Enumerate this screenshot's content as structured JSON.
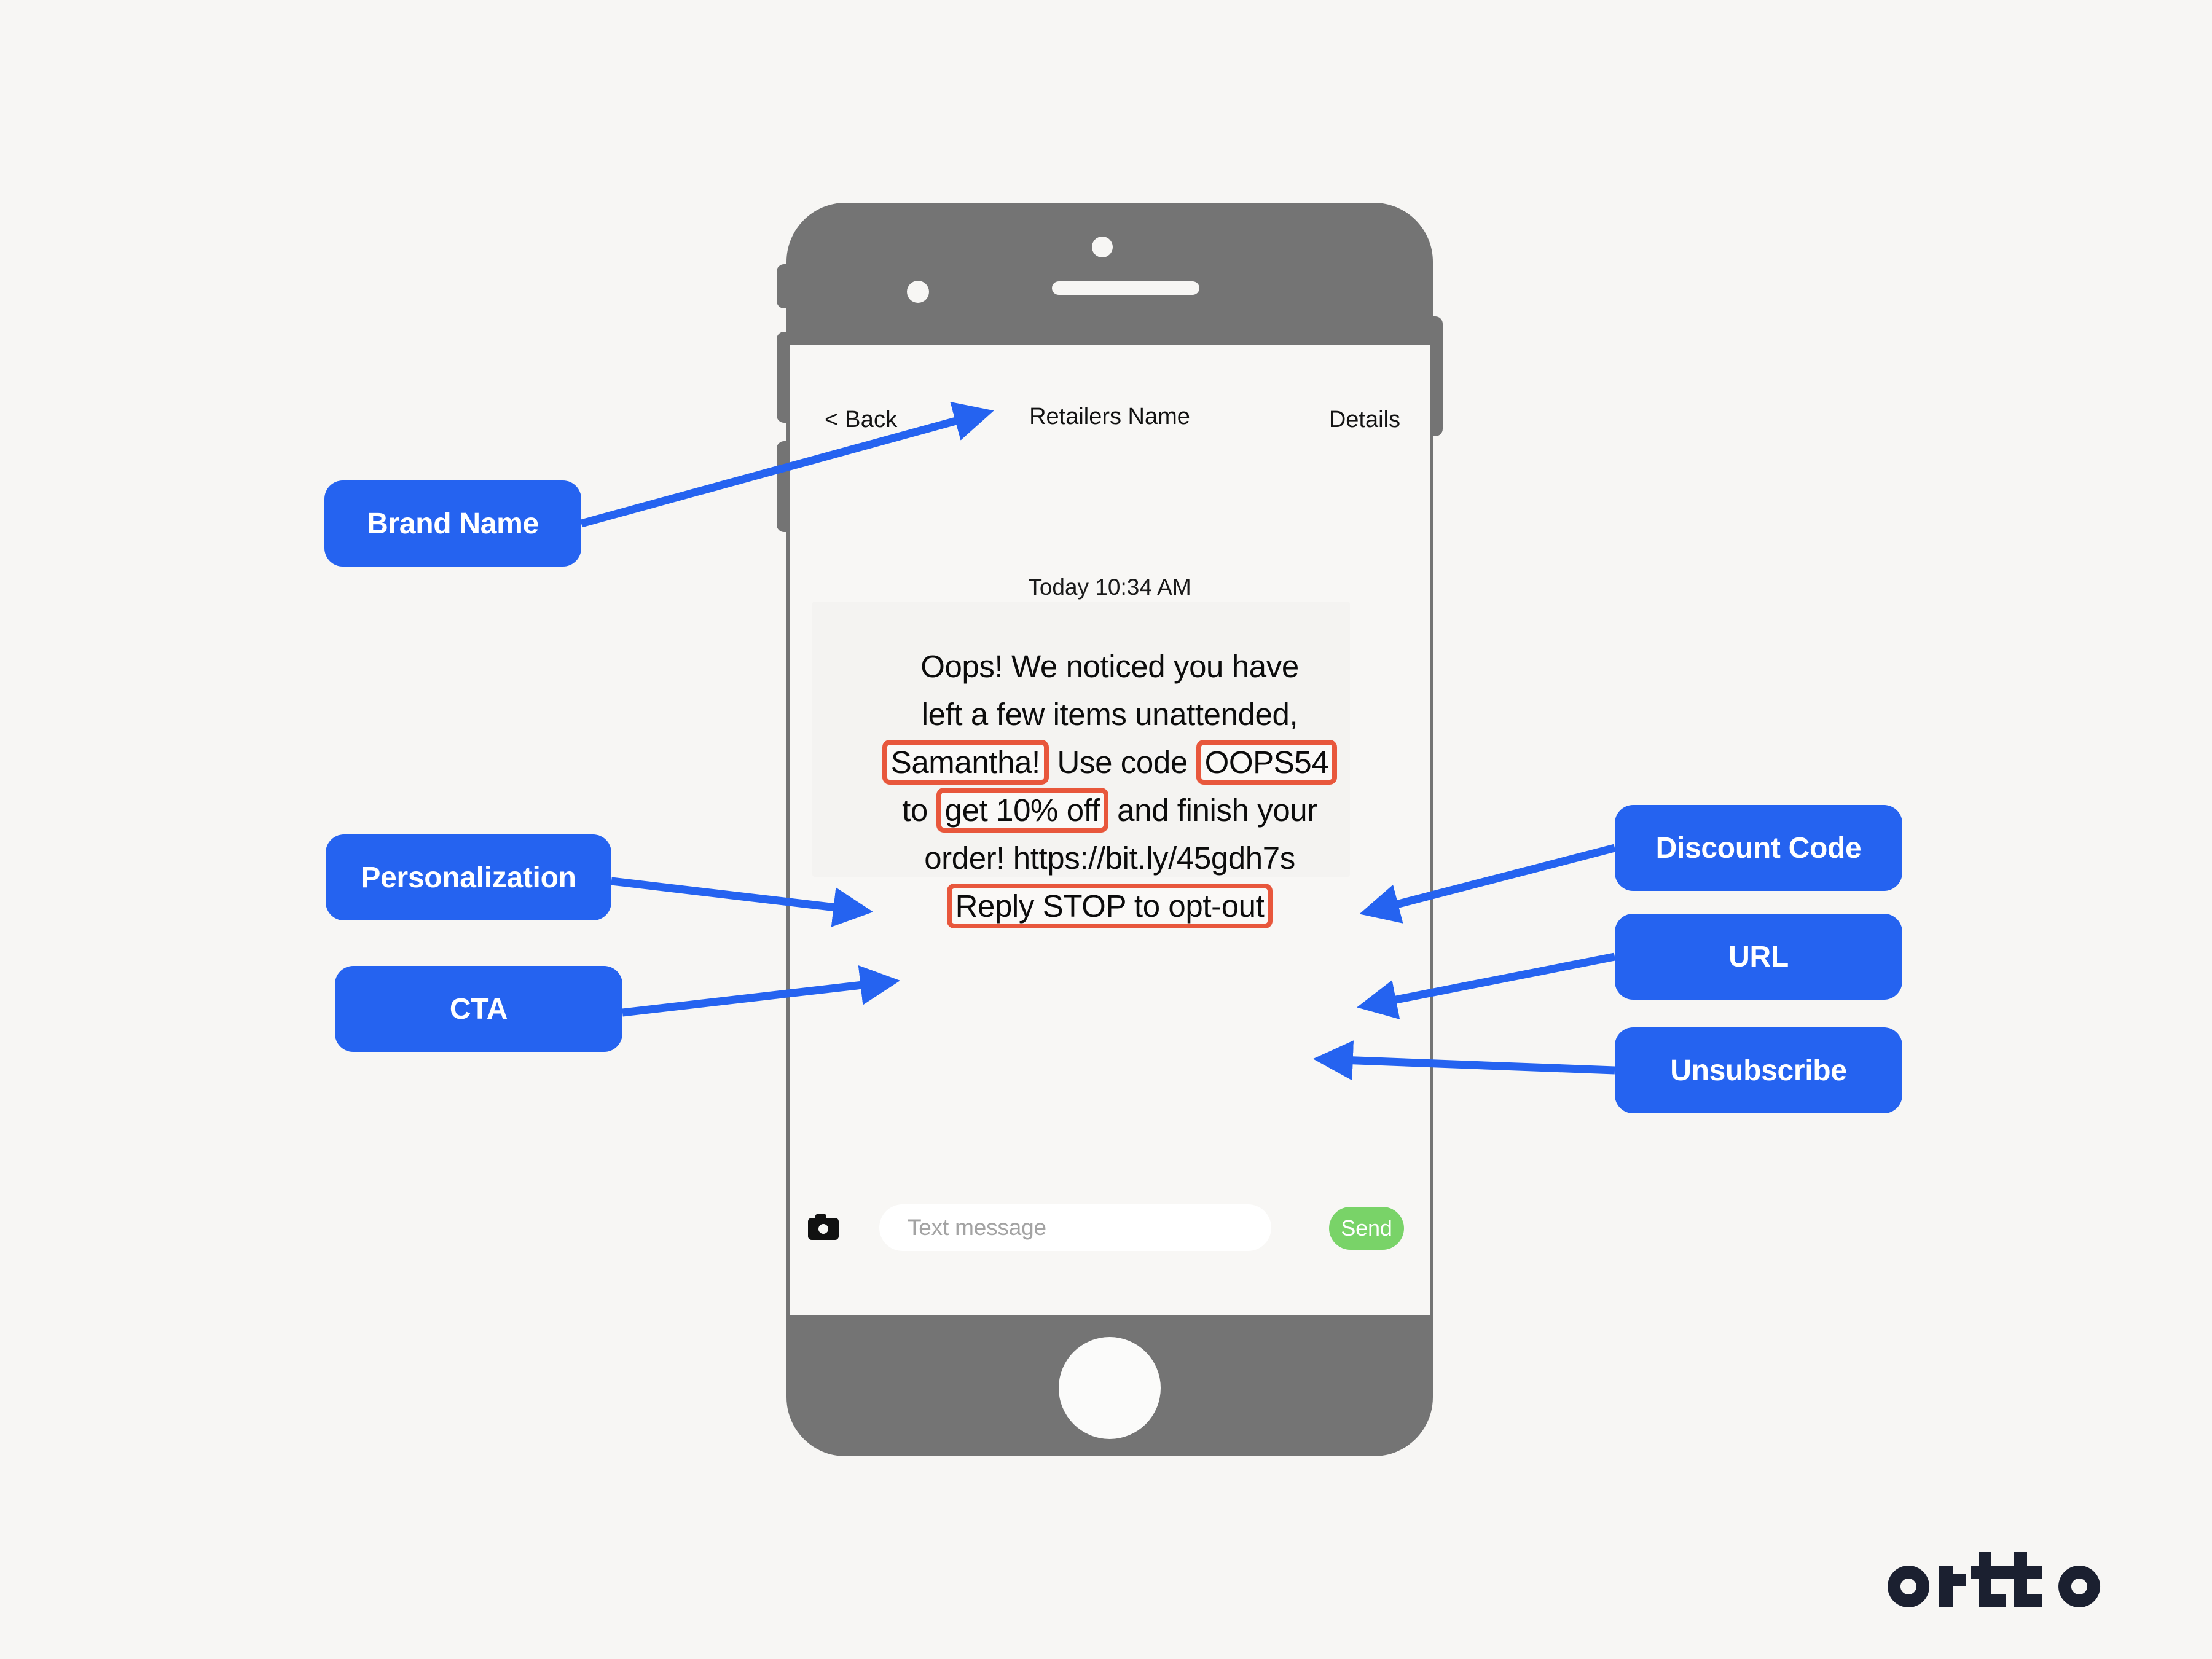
{
  "canvas": {
    "background": "#f7f6f4",
    "accent_blue": "#2563f0",
    "highlight_orange": "#e8573c",
    "phone_body": "#747474",
    "send_green": "#79d368",
    "logo_color": "#1b2030"
  },
  "phone": {
    "screen": {
      "header": {
        "back_label": "< Back",
        "title": "Retailers Name",
        "details_label": "Details"
      },
      "timestamp": "Today 10:34 AM",
      "message": {
        "line1": "Oops! We noticed you have",
        "line2": "left a few items unattended,",
        "personalization": "Samantha!",
        "use_code_label": "Use code",
        "discount_code": "OOPS54",
        "to_word": "to",
        "cta": "get 10% off",
        "and_finish": "and finish your",
        "order_word": "order!",
        "url": "https://bit.ly/45gdh7s",
        "unsubscribe": "Reply STOP to opt-out"
      },
      "composer": {
        "camera_icon": "camera-icon",
        "input_placeholder": "Text message",
        "send_label": "Send"
      }
    }
  },
  "callouts": {
    "brand_name": "Brand Name",
    "personalization": "Personalization",
    "cta": "CTA",
    "discount_code": "Discount Code",
    "url": "URL",
    "unsubscribe": "Unsubscribe"
  },
  "branding": {
    "logo_text": "ortto"
  }
}
